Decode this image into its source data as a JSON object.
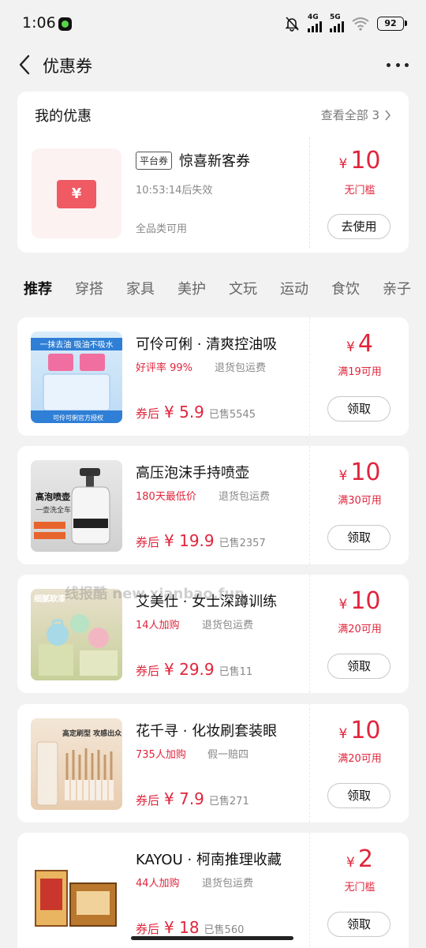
{
  "status_bar": {
    "time": "1:06",
    "battery": "92",
    "net1": "4G",
    "net2": "5G"
  },
  "header": {
    "title": "优惠券"
  },
  "my_coupon": {
    "section_title": "我的优惠",
    "view_all": "查看全部 3",
    "tag": "平台券",
    "name": "惊喜新客券",
    "expire": "10:53:14后失效",
    "scope": "全品类可用",
    "currency": "¥",
    "amount": "10",
    "condition": "无门槛",
    "button": "去使用"
  },
  "tabs": [
    "推荐",
    "穿搭",
    "家具",
    "美护",
    "文玩",
    "运动",
    "食饮",
    "亲子"
  ],
  "products": [
    {
      "name": "可伶可俐 · 清爽控油吸",
      "tag1": "好评率 99%",
      "tag2": "退货包运费",
      "after_label": "券后",
      "price": "¥ 5.9",
      "sold": "已售5545",
      "coupon_amount": "4",
      "condition": "满19可用",
      "button": "领取",
      "img_text": "一抹去油 吸油不吸水",
      "img_sub": "可伶可俐官方授权"
    },
    {
      "name": "高压泡沫手持喷壶",
      "tag1": "180天最低价",
      "tag2": "退货包运费",
      "after_label": "券后",
      "price": "¥ 19.9",
      "sold": "已售2357",
      "coupon_amount": "10",
      "condition": "满30可用",
      "button": "领取",
      "img_text": "高泡喷壶",
      "img_sub": "一壶洗全车"
    },
    {
      "name": "艾美仕 · 女士深蹲训练",
      "tag1": "14人加购",
      "tag2": "退货包运费",
      "after_label": "券后",
      "price": "¥ 29.9",
      "sold": "已售11",
      "coupon_amount": "10",
      "condition": "满20可用",
      "button": "领取",
      "img_text": "细腻软漆",
      "img_sub": ""
    },
    {
      "name": "花千寻 · 化妆刷套装眼",
      "tag1": "735人加购",
      "tag2": "假一赔四",
      "after_label": "券后",
      "price": "¥ 7.9",
      "sold": "已售271",
      "coupon_amount": "10",
      "condition": "满20可用",
      "button": "领取",
      "img_text": "高定刷型 攻感出众",
      "img_sub": ""
    },
    {
      "name": "KAYOU · 柯南推理收藏",
      "tag1": "44人加购",
      "tag2": "退货包运费",
      "after_label": "券后",
      "price": "¥ 18",
      "sold": "已售560",
      "coupon_amount": "2",
      "condition": "无门槛",
      "button": "领取",
      "img_text": "",
      "img_sub": ""
    }
  ],
  "currency": "¥",
  "watermark": "线报酷 new.xianbao.fun"
}
